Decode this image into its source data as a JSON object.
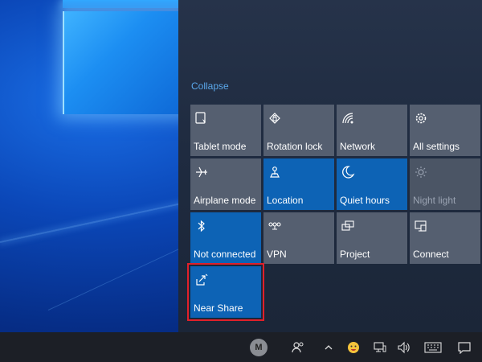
{
  "action_center": {
    "collapse_label": "Collapse",
    "tiles": [
      {
        "label": "Tablet mode",
        "icon": "tablet-mode-icon",
        "state": "off"
      },
      {
        "label": "Rotation lock",
        "icon": "rotation-lock-icon",
        "state": "off"
      },
      {
        "label": "Network",
        "icon": "network-icon",
        "state": "off"
      },
      {
        "label": "All settings",
        "icon": "gear-icon",
        "state": "off"
      },
      {
        "label": "Airplane mode",
        "icon": "airplane-icon",
        "state": "off"
      },
      {
        "label": "Location",
        "icon": "location-icon",
        "state": "on"
      },
      {
        "label": "Quiet hours",
        "icon": "moon-icon",
        "state": "on"
      },
      {
        "label": "Night light",
        "icon": "brightness-icon",
        "state": "disabled"
      },
      {
        "label": "Not connected",
        "icon": "bluetooth-icon",
        "state": "on"
      },
      {
        "label": "VPN",
        "icon": "vpn-icon",
        "state": "off"
      },
      {
        "label": "Project",
        "icon": "project-icon",
        "state": "off"
      },
      {
        "label": "Connect",
        "icon": "connect-icon",
        "state": "off"
      },
      {
        "label": "Near Share",
        "icon": "near-share-icon",
        "state": "on",
        "highlighted": true
      }
    ],
    "colors": {
      "tile_off": "#555f70",
      "tile_on": "#0d63b5",
      "highlight": "#e0202a",
      "collapse_link": "#5aa7ea"
    }
  },
  "taskbar": {
    "avatar_letter": "M",
    "icons": [
      "avatar",
      "people-icon",
      "chevron-up-icon",
      "emoji-icon",
      "network-status-icon",
      "volume-icon",
      "keyboard-icon",
      "notification-icon"
    ]
  }
}
